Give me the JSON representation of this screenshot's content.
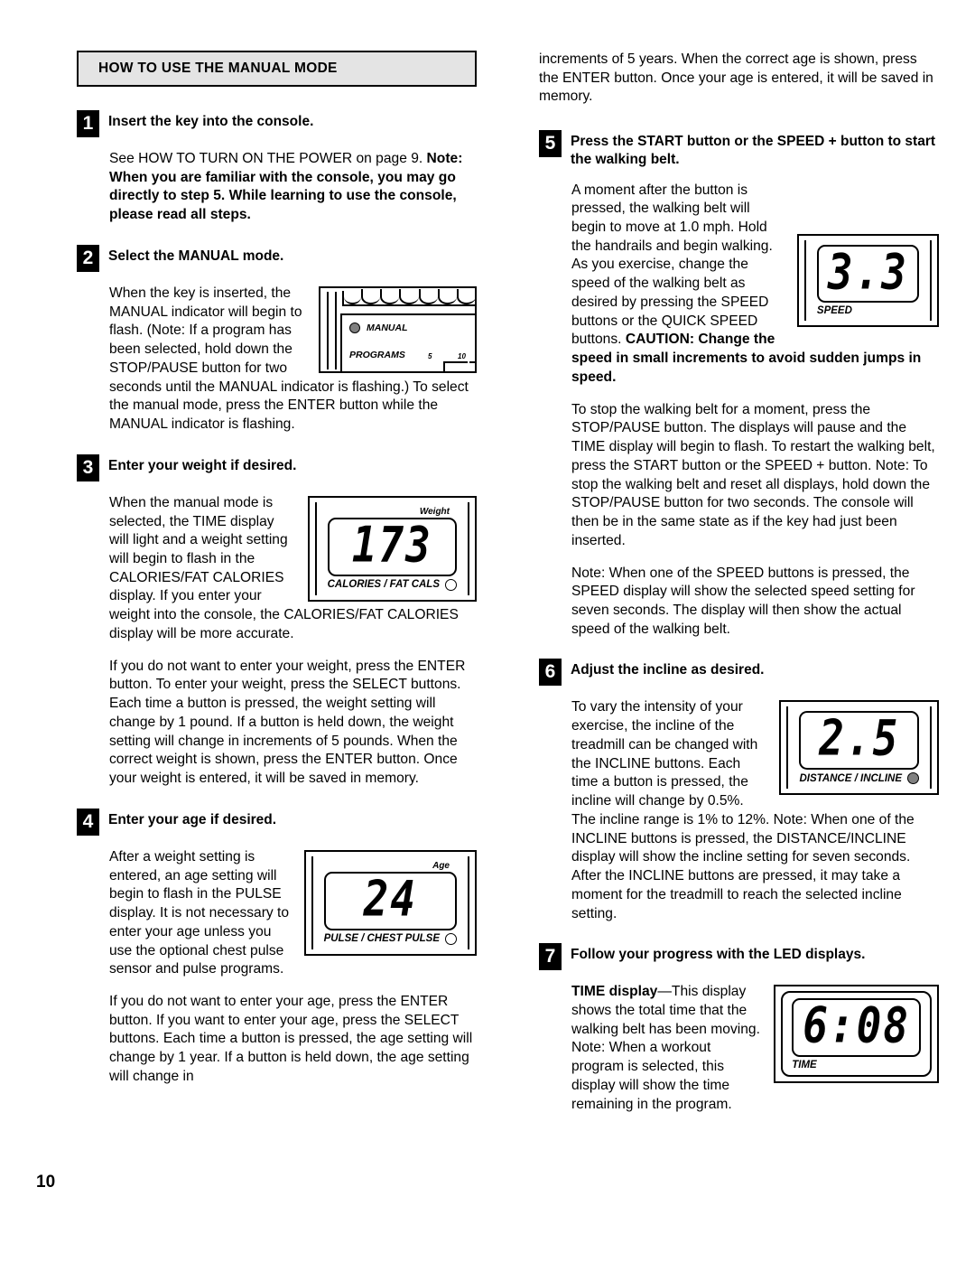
{
  "page": {
    "number": "10",
    "section_title": "HOW TO USE THE MANUAL MODE"
  },
  "steps": [
    {
      "num": "1",
      "title": "Insert the key into the console.",
      "paragraphs": [
        {
          "plain": "See HOW TO TURN ON THE POWER on page 9. ",
          "bold": "Note: When you are familiar with the console, you may go directly to step 5. While learning to use the console, please read all steps."
        }
      ]
    },
    {
      "num": "2",
      "title": "Select the MANUAL mode.",
      "paragraphs": [
        {
          "plain": "When the key is inserted, the MANUAL indicator will begin to flash. (Note: If a program has been selected, hold down the STOP/PAUSE button for two seconds until the MANUAL indicator is flashing.) To select the manual mode, press the ENTER button while the MANUAL indicator is flashing."
        }
      ],
      "figure": {
        "type": "console",
        "manual_label": "MANUAL",
        "programs_label": "PROGRAMS",
        "tick_5": "5",
        "tick_10": "10"
      }
    },
    {
      "num": "3",
      "title": "Enter your weight if desired.",
      "paragraphs": [
        {
          "plain": "When the manual mode is selected, the TIME display will light and a weight setting will begin to flash in the CALORIES/FAT CALORIES display. If you enter your weight into the console, the CALORIES/FAT CALORIES display will be more accurate."
        },
        {
          "plain": "If you do not want to enter your weight, press the ENTER button. To enter your weight, press the SELECT buttons. Each time a button is pressed, the weight setting will change by 1 pound. If a button is held down, the weight setting will change in increments of 5 pounds. When the correct weight is shown, press the ENTER button. Once your weight is entered, it will be saved in memory."
        }
      ],
      "figure": {
        "type": "led",
        "label_top": "Weight",
        "digits": "173",
        "label_bottom": "CALORIES / FAT CALS",
        "indicator": "hollow"
      }
    },
    {
      "num": "4",
      "title": "Enter your age if desired.",
      "paragraphs": [
        {
          "plain": "After a weight setting is entered, an age setting will begin to flash in the PULSE display. It is not necessary to enter your age unless you use the optional chest pulse sensor and pulse programs."
        },
        {
          "plain": "If you do not want to enter your age, press the ENTER button. If you want to enter your age, press the SELECT buttons. Each time a button is pressed, the age setting will change by 1 year. If a button is held down, the age setting will change in"
        }
      ],
      "figure": {
        "type": "led",
        "label_top": "Age",
        "digits": "24",
        "label_bottom": "PULSE / CHEST PULSE",
        "indicator": "hollow"
      }
    },
    {
      "num": "5",
      "title": "Press the START button or the SPEED + button to start the walking belt.",
      "lead_in": "increments of 5 years. When the correct age is shown, press the ENTER button. Once your age is entered, it will be saved in memory.",
      "paragraphs": [
        {
          "plain": "A moment after the button is pressed, the walking belt will begin to move at 1.0 mph. Hold the handrails and begin walking. As you exercise, change the speed of the walking belt as desired by pressing the SPEED buttons or the QUICK SPEED buttons. ",
          "bold": "CAUTION: Change the speed in small increments to avoid sudden jumps in speed."
        },
        {
          "plain": "To stop the walking belt for a moment, press the STOP/PAUSE button. The displays will pause and the TIME display will begin to flash. To restart the walking belt, press the START button or the SPEED + button. Note: To stop the walking belt and reset all displays, hold down the STOP/PAUSE button for two seconds. The console will then be in the same state as if the key had just been inserted."
        },
        {
          "plain": "Note: When one of the SPEED buttons is pressed, the SPEED display will show the selected speed setting for seven seconds. The display will then show the actual speed of the walking belt."
        }
      ],
      "figure": {
        "type": "led",
        "label_top": "",
        "digits": "3.3",
        "label_bottom": "SPEED",
        "indicator": "none"
      }
    },
    {
      "num": "6",
      "title": "Adjust the incline as desired.",
      "paragraphs": [
        {
          "plain": "To vary the intensity of your exercise, the incline of the treadmill can be changed with the INCLINE buttons. Each time a button is pressed, the incline will change by 0.5%. The incline range is 1% to 12%. Note: When one of the INCLINE buttons is pressed, the DISTANCE/INCLINE display will show the incline setting for seven seconds. After the INCLINE buttons are pressed, it may take a moment for the treadmill to reach the selected incline setting."
        }
      ],
      "figure": {
        "type": "led",
        "label_top": "",
        "digits": "2.5",
        "label_bottom": "DISTANCE / INCLINE",
        "indicator": "filled"
      }
    },
    {
      "num": "7",
      "title": "Follow your progress with the LED displays.",
      "paragraphs": [
        {
          "bold_lead": "TIME display",
          "plain": "—This display shows the total time that the walking belt has been moving. Note: When a workout program is selected, this display will show the time remaining in the program."
        }
      ],
      "figure": {
        "type": "led-time",
        "label_top": "",
        "digits": "6:08",
        "label_bottom": "TIME",
        "indicator": "none"
      }
    }
  ]
}
